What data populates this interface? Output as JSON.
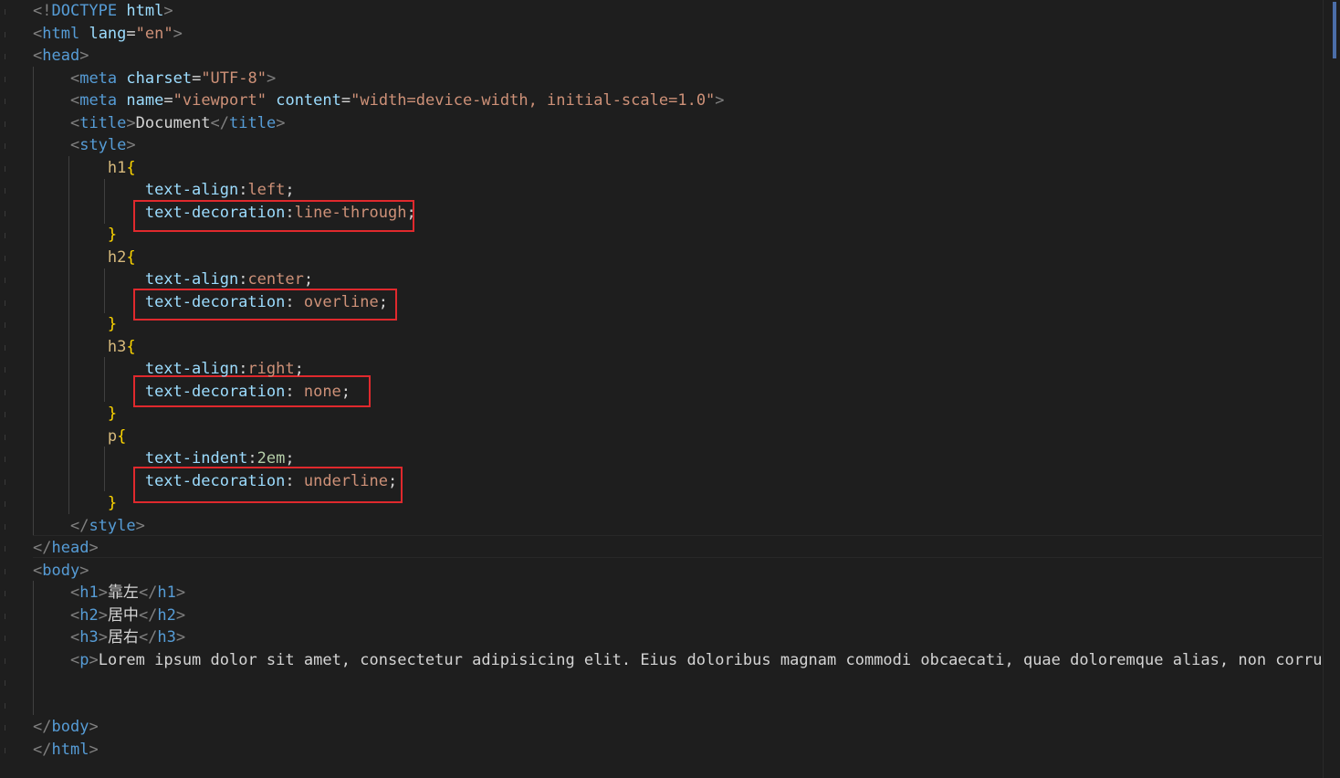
{
  "editor": {
    "lines": [
      {
        "tokens": [
          [
            "br",
            "<!"
          ],
          [
            "decl",
            "DOCTYPE"
          ],
          [
            "txt",
            " "
          ],
          [
            "attr",
            "html"
          ],
          [
            "br",
            ">"
          ]
        ]
      },
      {
        "tokens": [
          [
            "br",
            "<"
          ],
          [
            "tag",
            "html"
          ],
          [
            "txt",
            " "
          ],
          [
            "attr",
            "lang"
          ],
          [
            "punct",
            "="
          ],
          [
            "str",
            "\"en\""
          ],
          [
            "br",
            ">"
          ]
        ]
      },
      {
        "tokens": [
          [
            "br",
            "<"
          ],
          [
            "tag",
            "head"
          ],
          [
            "br",
            ">"
          ]
        ]
      },
      {
        "tokens": [
          [
            "txt",
            "    "
          ],
          [
            "br",
            "<"
          ],
          [
            "tag",
            "meta"
          ],
          [
            "txt",
            " "
          ],
          [
            "attr",
            "charset"
          ],
          [
            "punct",
            "="
          ],
          [
            "str",
            "\"UTF-8\""
          ],
          [
            "br",
            ">"
          ]
        ]
      },
      {
        "tokens": [
          [
            "txt",
            "    "
          ],
          [
            "br",
            "<"
          ],
          [
            "tag",
            "meta"
          ],
          [
            "txt",
            " "
          ],
          [
            "attr",
            "name"
          ],
          [
            "punct",
            "="
          ],
          [
            "str",
            "\"viewport\""
          ],
          [
            "txt",
            " "
          ],
          [
            "attr",
            "content"
          ],
          [
            "punct",
            "="
          ],
          [
            "str",
            "\"width=device-width, initial-scale=1.0\""
          ],
          [
            "br",
            ">"
          ]
        ]
      },
      {
        "tokens": [
          [
            "txt",
            "    "
          ],
          [
            "br",
            "<"
          ],
          [
            "tag",
            "title"
          ],
          [
            "br",
            ">"
          ],
          [
            "txt",
            "Document"
          ],
          [
            "br",
            "</"
          ],
          [
            "tag",
            "title"
          ],
          [
            "br",
            ">"
          ]
        ]
      },
      {
        "tokens": [
          [
            "txt",
            "    "
          ],
          [
            "br",
            "<"
          ],
          [
            "tag",
            "style"
          ],
          [
            "br",
            ">"
          ]
        ]
      },
      {
        "tokens": [
          [
            "txt",
            "        "
          ],
          [
            "sel",
            "h1"
          ],
          [
            "brace",
            "{"
          ]
        ]
      },
      {
        "tokens": [
          [
            "txt",
            "            "
          ],
          [
            "prop",
            "text-align"
          ],
          [
            "punct",
            ":"
          ],
          [
            "val",
            "left"
          ],
          [
            "punct",
            ";"
          ]
        ]
      },
      {
        "tokens": [
          [
            "txt",
            "            "
          ],
          [
            "prop",
            "text-decoration"
          ],
          [
            "punct",
            ":"
          ],
          [
            "val",
            "line-through"
          ],
          [
            "punct",
            ";"
          ]
        ]
      },
      {
        "tokens": [
          [
            "txt",
            "        "
          ],
          [
            "brace",
            "}"
          ]
        ]
      },
      {
        "tokens": [
          [
            "txt",
            "        "
          ],
          [
            "sel",
            "h2"
          ],
          [
            "brace",
            "{"
          ]
        ]
      },
      {
        "tokens": [
          [
            "txt",
            "            "
          ],
          [
            "prop",
            "text-align"
          ],
          [
            "punct",
            ":"
          ],
          [
            "val",
            "center"
          ],
          [
            "punct",
            ";"
          ]
        ]
      },
      {
        "tokens": [
          [
            "txt",
            "            "
          ],
          [
            "prop",
            "text-decoration"
          ],
          [
            "punct",
            ": "
          ],
          [
            "val",
            "overline"
          ],
          [
            "punct",
            ";"
          ]
        ]
      },
      {
        "tokens": [
          [
            "txt",
            "        "
          ],
          [
            "brace",
            "}"
          ]
        ]
      },
      {
        "tokens": [
          [
            "txt",
            "        "
          ],
          [
            "sel",
            "h3"
          ],
          [
            "brace",
            "{"
          ]
        ]
      },
      {
        "tokens": [
          [
            "txt",
            "            "
          ],
          [
            "prop",
            "text-align"
          ],
          [
            "punct",
            ":"
          ],
          [
            "val",
            "right"
          ],
          [
            "punct",
            ";"
          ]
        ]
      },
      {
        "tokens": [
          [
            "txt",
            "            "
          ],
          [
            "prop",
            "text-decoration"
          ],
          [
            "punct",
            ": "
          ],
          [
            "val",
            "none"
          ],
          [
            "punct",
            ";"
          ]
        ]
      },
      {
        "tokens": [
          [
            "txt",
            "        "
          ],
          [
            "brace",
            "}"
          ]
        ]
      },
      {
        "tokens": [
          [
            "txt",
            "        "
          ],
          [
            "sel",
            "p"
          ],
          [
            "brace",
            "{"
          ]
        ]
      },
      {
        "tokens": [
          [
            "txt",
            "            "
          ],
          [
            "prop",
            "text-indent"
          ],
          [
            "punct",
            ":"
          ],
          [
            "num",
            "2em"
          ],
          [
            "punct",
            ";"
          ]
        ]
      },
      {
        "tokens": [
          [
            "txt",
            "            "
          ],
          [
            "prop",
            "text-decoration"
          ],
          [
            "punct",
            ": "
          ],
          [
            "val",
            "underline"
          ],
          [
            "punct",
            ";"
          ]
        ]
      },
      {
        "tokens": [
          [
            "txt",
            "        "
          ],
          [
            "brace",
            "}"
          ]
        ]
      },
      {
        "tokens": [
          [
            "txt",
            "    "
          ],
          [
            "br",
            "</"
          ],
          [
            "tag",
            "style"
          ],
          [
            "br",
            ">"
          ]
        ]
      },
      {
        "tokens": [
          [
            "br",
            "</"
          ],
          [
            "tag",
            "head"
          ],
          [
            "br",
            ">"
          ]
        ]
      },
      {
        "tokens": [
          [
            "br",
            "<"
          ],
          [
            "tag",
            "body"
          ],
          [
            "br",
            ">"
          ]
        ]
      },
      {
        "tokens": [
          [
            "txt",
            "    "
          ],
          [
            "br",
            "<"
          ],
          [
            "tag",
            "h1"
          ],
          [
            "br",
            ">"
          ],
          [
            "txt",
            "靠左"
          ],
          [
            "br",
            "</"
          ],
          [
            "tag",
            "h1"
          ],
          [
            "br",
            ">"
          ]
        ]
      },
      {
        "tokens": [
          [
            "txt",
            "    "
          ],
          [
            "br",
            "<"
          ],
          [
            "tag",
            "h2"
          ],
          [
            "br",
            ">"
          ],
          [
            "txt",
            "居中"
          ],
          [
            "br",
            "</"
          ],
          [
            "tag",
            "h2"
          ],
          [
            "br",
            ">"
          ]
        ]
      },
      {
        "tokens": [
          [
            "txt",
            "    "
          ],
          [
            "br",
            "<"
          ],
          [
            "tag",
            "h3"
          ],
          [
            "br",
            ">"
          ],
          [
            "txt",
            "居右"
          ],
          [
            "br",
            "</"
          ],
          [
            "tag",
            "h3"
          ],
          [
            "br",
            ">"
          ]
        ]
      },
      {
        "tokens": [
          [
            "txt",
            "    "
          ],
          [
            "br",
            "<"
          ],
          [
            "tag",
            "p"
          ],
          [
            "br",
            ">"
          ],
          [
            "txt",
            "Lorem ipsum dolor sit amet, consectetur adipisicing elit. Eius doloribus magnam commodi obcaecati, quae doloremque alias, non corrupti o"
          ]
        ]
      },
      {
        "tokens": []
      },
      {
        "tokens": []
      },
      {
        "tokens": [
          [
            "br",
            "</"
          ],
          [
            "tag",
            "body"
          ],
          [
            "br",
            ">"
          ]
        ]
      },
      {
        "tokens": [
          [
            "br",
            "</"
          ],
          [
            "tag",
            "html"
          ],
          [
            "br",
            ">"
          ]
        ]
      }
    ]
  },
  "colors": {
    "background": "#1e1e1e",
    "highlight_box": "#e0292d"
  }
}
